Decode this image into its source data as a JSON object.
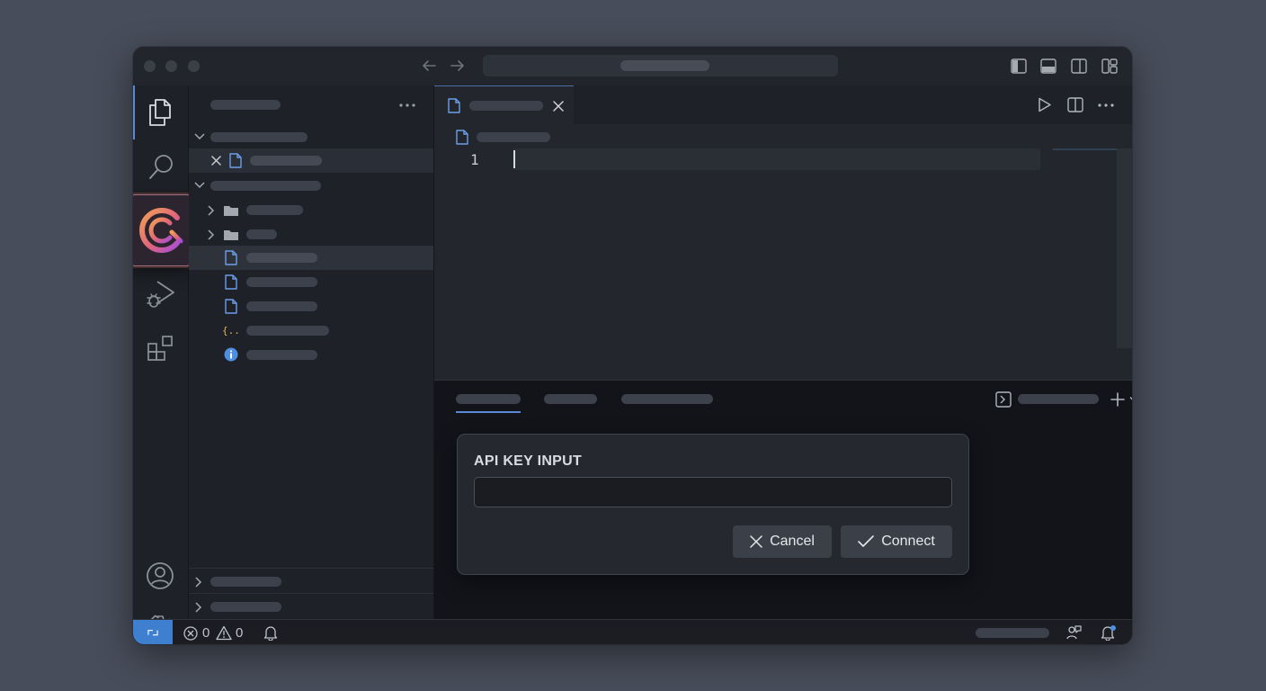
{
  "app": {
    "window": "code-editor"
  },
  "editor": {
    "line_numbers": [
      "1"
    ]
  },
  "api_key_dialog": {
    "title": "API KEY INPUT",
    "input_value": "",
    "input_placeholder": "",
    "cancel_label": "Cancel",
    "connect_label": "Connect"
  },
  "status_bar": {
    "errors": "0",
    "warnings": "0"
  },
  "colors": {
    "accent": "#5a8ad6",
    "remote_indicator": "#3f7fd0",
    "json_icon": "#e5b54a",
    "info_icon": "#4d8fe3",
    "file_icon": "#6a9ee8"
  },
  "icons": [
    "explorer-icon",
    "search-icon",
    "extension-logo-icon",
    "run-debug-icon",
    "extensions-icon",
    "account-icon",
    "settings-gear-icon",
    "file-icon",
    "folder-icon",
    "json-braces-icon",
    "info-icon",
    "run-icon",
    "split-editor-icon",
    "more-icon",
    "terminal-icon",
    "add-icon",
    "trash-icon",
    "chevron-up-icon",
    "close-icon",
    "bell-icon",
    "remote-icon"
  ]
}
